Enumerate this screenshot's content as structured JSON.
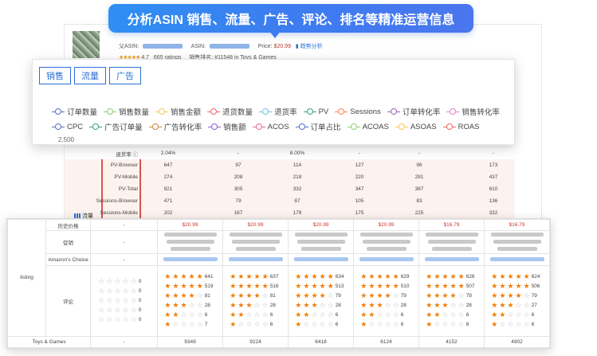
{
  "banner": {
    "text": "分析ASIN 销售、流量、广告、评论、排名等精准运营信息"
  },
  "product": {
    "parent_asin_label": "父ASIN:",
    "asin_label": "ASIN:",
    "price_label": "Price:",
    "price_value": "$20.99",
    "trend_label": "趋势分析",
    "rating_value": "4.7",
    "ratings_count": "665 ratings",
    "rank_text": "销售排名: #11548 in Toys & Games"
  },
  "tabs": [
    "销售",
    "流量",
    "广告"
  ],
  "legend": {
    "row1": [
      {
        "label": "订单数量",
        "color": "#5470c6"
      },
      {
        "label": "销售数量",
        "color": "#91cc75"
      },
      {
        "label": "销售金额",
        "color": "#fac858"
      },
      {
        "label": "退货数量",
        "color": "#ee6666"
      },
      {
        "label": "退货率",
        "color": "#73c0de"
      },
      {
        "label": "PV",
        "color": "#3ba272"
      },
      {
        "label": "Sessions",
        "color": "#fc8452"
      },
      {
        "label": "订单转化率",
        "color": "#9a60b4"
      },
      {
        "label": "销售转化率",
        "color": "#ea7ccc"
      }
    ],
    "row2": [
      {
        "label": "CPC",
        "color": "#5470c6"
      },
      {
        "label": "广告订单量",
        "color": "#3ba272"
      },
      {
        "label": "广告转化率",
        "color": "#d4843a"
      },
      {
        "label": "销售额",
        "color": "#8b5cd6"
      },
      {
        "label": "ACOS",
        "color": "#e86a9a"
      },
      {
        "label": "订单占比",
        "color": "#5470c6"
      },
      {
        "label": "ACOAS",
        "color": "#91cc75"
      },
      {
        "label": "ASOAS",
        "color": "#fac858"
      },
      {
        "label": "ROAS",
        "color": "#ee6666"
      }
    ],
    "y_tick": "2,500"
  },
  "mid_table": {
    "flow_label": "流量",
    "rows": [
      {
        "label": "退货率 ⓘ",
        "values": [
          "2.04%",
          "-",
          "8.00%",
          "-",
          "-",
          "-"
        ]
      },
      {
        "label": "PV-Browser",
        "values": [
          "647",
          "97",
          "114",
          "127",
          "96",
          "173"
        ]
      },
      {
        "label": "PV-Mobile",
        "values": [
          "274",
          "208",
          "218",
          "220",
          "291",
          "437"
        ]
      },
      {
        "label": "PV-Total",
        "values": [
          "921",
          "305",
          "332",
          "347",
          "387",
          "610"
        ]
      },
      {
        "label": "Sessions-Browser",
        "values": [
          "471",
          "79",
          "87",
          "105",
          "83",
          "136"
        ]
      },
      {
        "label": "Sessions-Mobile",
        "values": [
          "202",
          "167",
          "179",
          "175",
          "225",
          "332"
        ]
      }
    ]
  },
  "listing": {
    "group_label": "listing",
    "history_price_label": "历史价格",
    "promo_label": "促销",
    "amazon_choice_label": "Amazon's Choice",
    "review_label": "评论",
    "category_label": "Toys & Games",
    "dash": "-",
    "prices": [
      "$20.99",
      "$20.99",
      "$20.99",
      "$20.99",
      "$16.79",
      "$16.79"
    ],
    "first_rating": [
      "0",
      "0",
      "0",
      "0",
      "0"
    ],
    "ratings": [
      [
        "641",
        "519",
        "81",
        "28",
        "6",
        "7"
      ],
      [
        "637",
        "516",
        "81",
        "28",
        "6",
        "6"
      ],
      [
        "634",
        "513",
        "79",
        "28",
        "6",
        "6"
      ],
      [
        "629",
        "510",
        "79",
        "28",
        "6",
        "6"
      ],
      [
        "626",
        "507",
        "79",
        "28",
        "6",
        "6"
      ],
      [
        "624",
        "506",
        "79",
        "27",
        "6",
        "6"
      ]
    ],
    "ranks": [
      "9349",
      "9224",
      "6418",
      "6124",
      "4152",
      "4902"
    ]
  }
}
